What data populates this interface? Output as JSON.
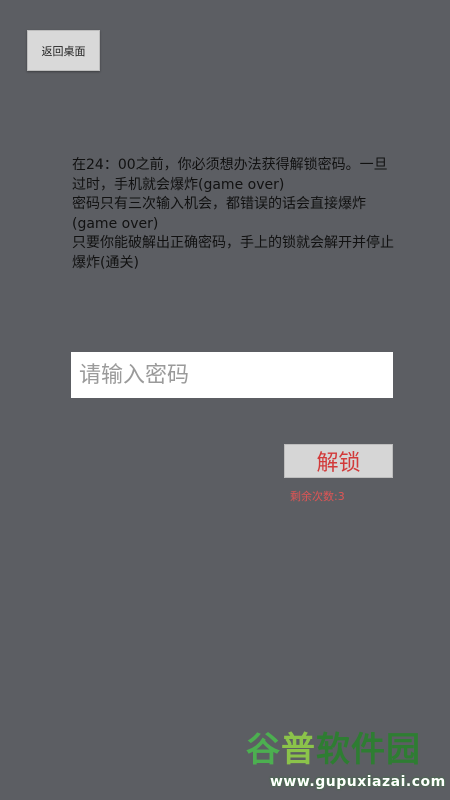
{
  "header": {
    "back_label": "返回桌面"
  },
  "instructions": {
    "lines": [
      "在24：00之前，你必须想办法获得解锁密码。一旦过时，手机就会爆炸(game over)",
      "密码只有三次输入机会，都错误的话会直接爆炸(game over)",
      "只要你能破解出正确密码，手上的锁就会解开并停止爆炸(通关)"
    ]
  },
  "password": {
    "value": "",
    "placeholder": "请输入密码"
  },
  "unlock": {
    "label": "解锁"
  },
  "attempts": {
    "label": "剩余次数:3"
  },
  "watermark": {
    "part1": "谷",
    "part2": "普",
    "part3": "软件园",
    "url": "www.gupuxiazai.com"
  },
  "colors": {
    "background": "#5c5e63",
    "button_bg": "#d6d6d6",
    "unlock_text": "#d23a3a",
    "attempts_text": "#e05555"
  }
}
